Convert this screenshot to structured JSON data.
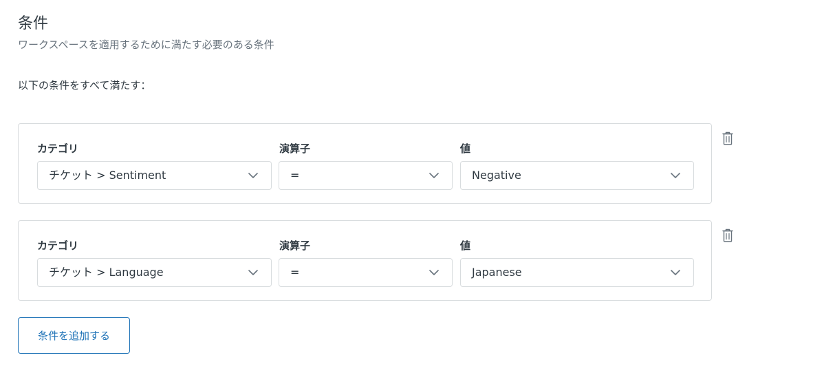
{
  "header": {
    "title": "条件",
    "subtitle": "ワークスペースを適用するために満たす必要のある条件"
  },
  "match_label": "以下の条件をすべて満たす：",
  "labels": {
    "category": "カテゴリ",
    "operator": "演算子",
    "value": "値"
  },
  "conditions": [
    {
      "category": "チケット > Sentiment",
      "operator": "=",
      "value": "Negative"
    },
    {
      "category": "チケット > Language",
      "operator": "=",
      "value": "Japanese"
    }
  ],
  "add_button_label": "条件を追加する",
  "icons": {
    "chevron": "chevron-down-icon",
    "delete": "trash-icon"
  },
  "colors": {
    "accent": "#1f73b7",
    "text": "#2f3941",
    "muted": "#68737d",
    "border": "#d8dcde"
  }
}
